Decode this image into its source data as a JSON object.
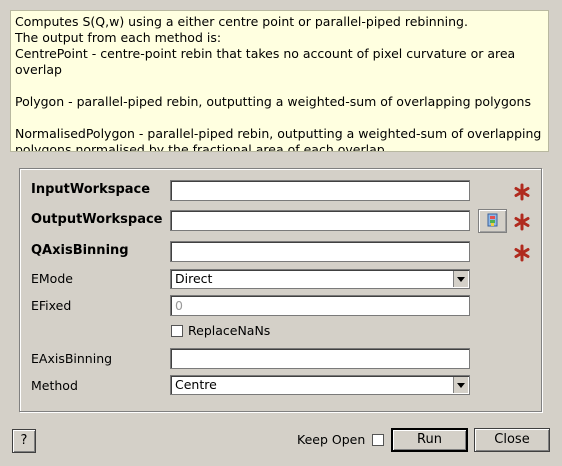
{
  "description": "Computes S(Q,w) using a either centre point or parallel-piped rebinning.\nThe output from each method is:\nCentrePoint - centre-point rebin that takes no account of pixel curvature or area overlap\n\nPolygon - parallel-piped rebin, outputting a weighted-sum of overlapping polygons\n\nNormalisedPolygon - parallel-piped rebin, outputting a weighted-sum of overlapping polygons normalised by the fractional area of each overlap",
  "fields": {
    "input_workspace": {
      "label": "InputWorkspace",
      "value": ""
    },
    "output_workspace": {
      "label": "OutputWorkspace",
      "value": ""
    },
    "qaxis_binning": {
      "label": "QAxisBinning",
      "value": ""
    },
    "emode": {
      "label": "EMode",
      "value": "Direct"
    },
    "efixed": {
      "label": "EFixed",
      "placeholder": "0"
    },
    "replace_nans": {
      "label": "ReplaceNaNs",
      "checked": false
    },
    "eaxis_binning": {
      "label": "EAxisBinning",
      "value": ""
    },
    "method": {
      "label": "Method",
      "value": "Centre"
    }
  },
  "footer": {
    "help_label": "?",
    "keep_open_label": "Keep Open",
    "run_label": "Run",
    "close_label": "Close"
  },
  "colors": {
    "required_star": "#b02a1e",
    "description_bg": "#ffffe0",
    "window_bg": "#d4d0c8"
  },
  "icons": {
    "required": "asterisk-icon",
    "browse": "browse-workspace-icon"
  }
}
